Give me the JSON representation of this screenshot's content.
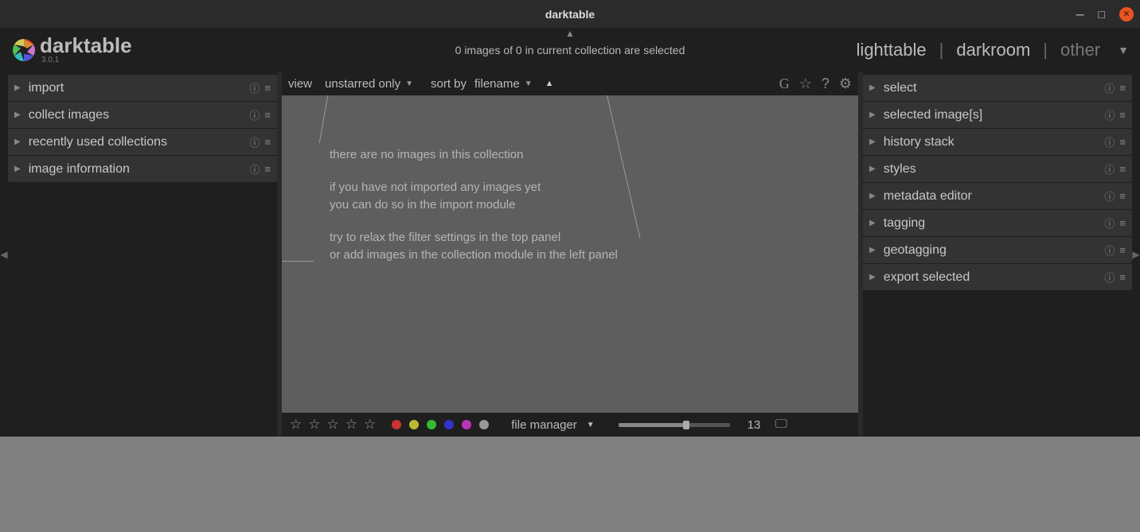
{
  "window": {
    "title": "darktable"
  },
  "app": {
    "name": "darktable",
    "version": "3.0.1"
  },
  "header": {
    "status": "0 images of 0 in current collection are selected",
    "views": {
      "lighttable": "lighttable",
      "darkroom": "darkroom",
      "other": "other",
      "sep": "|"
    }
  },
  "left_modules": [
    {
      "label": "import"
    },
    {
      "label": "collect images"
    },
    {
      "label": "recently used collections"
    },
    {
      "label": "image information"
    }
  ],
  "right_modules": [
    {
      "label": "select"
    },
    {
      "label": "selected image[s]"
    },
    {
      "label": "history stack"
    },
    {
      "label": "styles"
    },
    {
      "label": "metadata editor"
    },
    {
      "label": "tagging"
    },
    {
      "label": "geotagging"
    },
    {
      "label": "export selected"
    }
  ],
  "toolbar": {
    "view_label": "view",
    "filter_value": "unstarred only",
    "sort_label": "sort by",
    "sort_value": "filename"
  },
  "canvas": {
    "line1": "there are no images in this collection",
    "line2": "if you have not imported any images yet",
    "line3": "you can do so in the import module",
    "line4": "try to relax the filter settings in the top panel",
    "line5": "or add images in the collection module in the left panel"
  },
  "bottom": {
    "layout": "file manager",
    "zoom": "13",
    "color_dots": [
      "#c33",
      "#bb3",
      "#3b3",
      "#33c",
      "#b3b",
      "#999"
    ]
  }
}
